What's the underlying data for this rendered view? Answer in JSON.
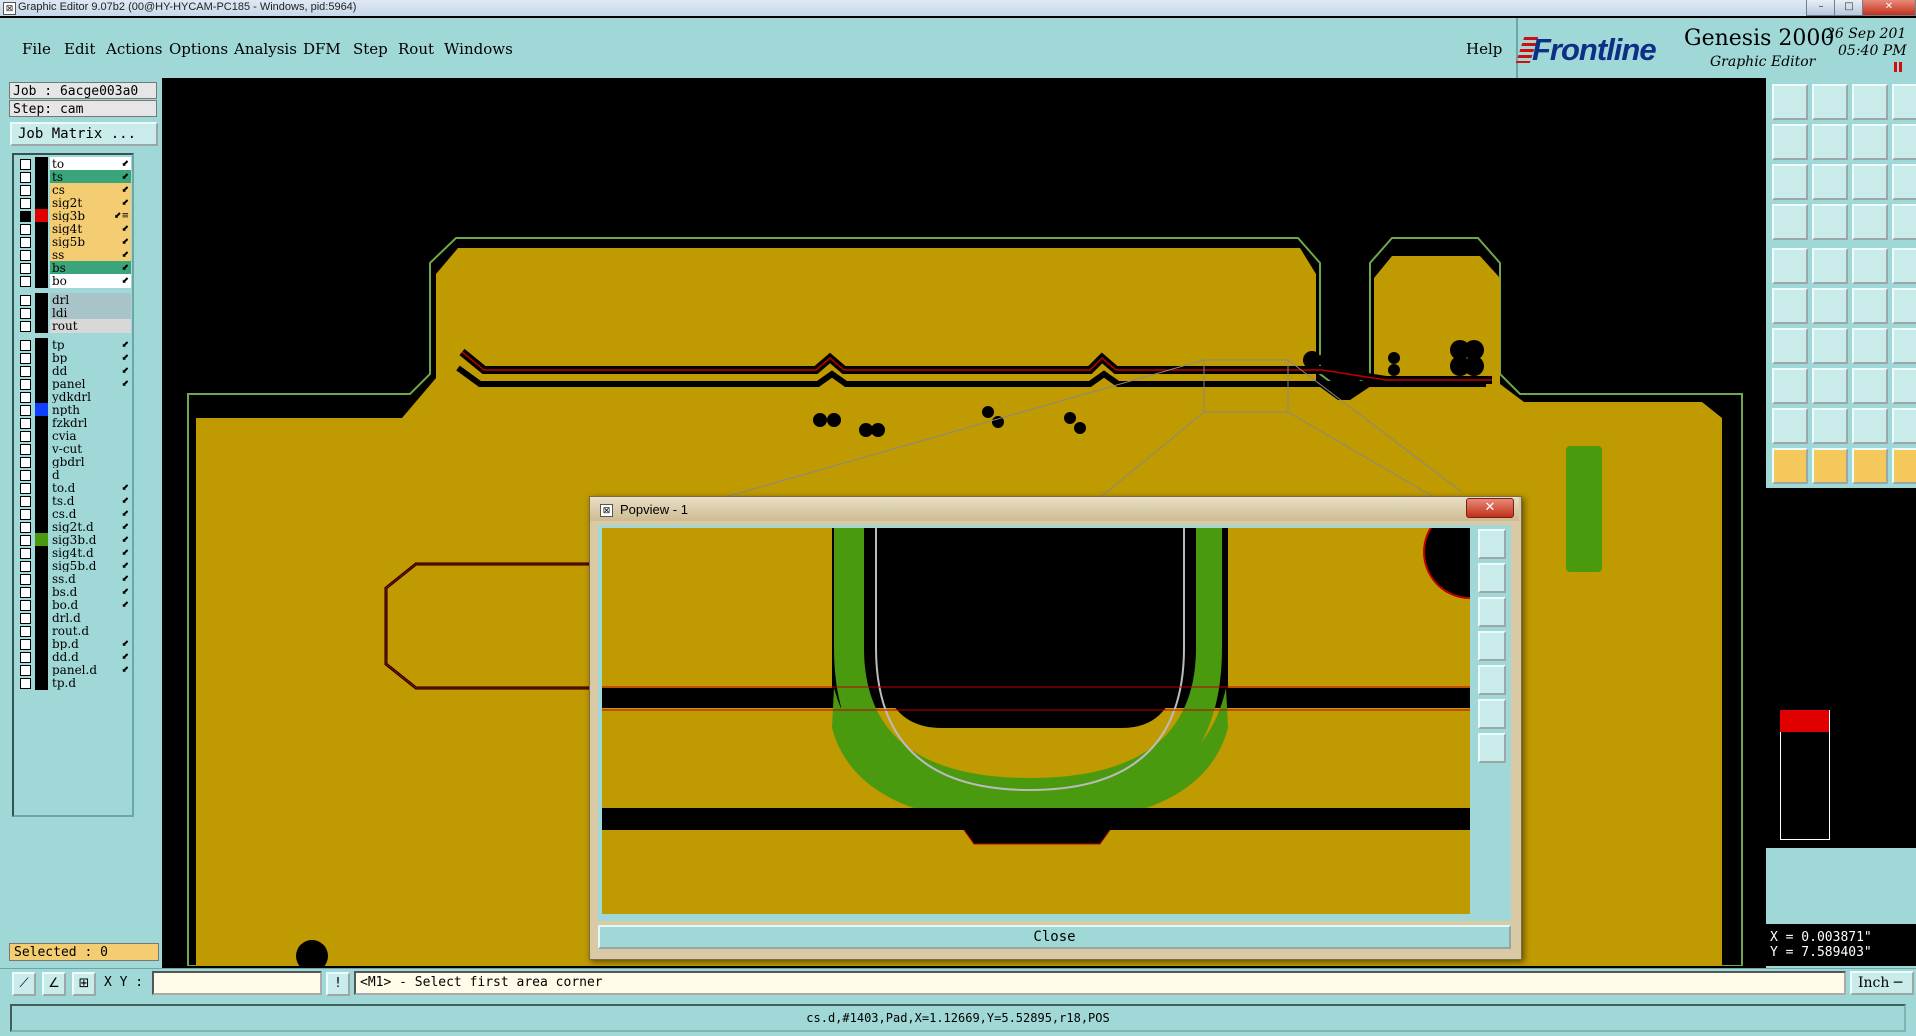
{
  "window": {
    "title": "Graphic Editor 9.07b2 (00@HY-HYCAM-PC185 - Windows, pid:5964)",
    "min": "–",
    "max": "□",
    "close": "✕"
  },
  "menu": [
    "File",
    "Edit",
    "Actions",
    "Options",
    "Analysis",
    "DFM",
    "Step",
    "Rout",
    "Windows"
  ],
  "help": "Help",
  "brand": {
    "logo": "Frontline",
    "product": "Genesis 2000",
    "sub": "Graphic Editor",
    "date": "26 Sep 201",
    "time": "05:40 PM"
  },
  "job": {
    "job": "Job : 6acge003a0",
    "step": "Step: cam",
    "matrix_button": "Job Matrix ..."
  },
  "layers": [
    {
      "name": "to",
      "color": "#ffffff",
      "arrow": "⬋"
    },
    {
      "name": "ts",
      "color": "#3aa57a",
      "arrow": "⬋"
    },
    {
      "name": "cs",
      "color": "#f4cd73",
      "arrow": "⬋"
    },
    {
      "name": "sig2t",
      "color": "#f4cd73",
      "arrow": "⬋"
    },
    {
      "name": "sig3b",
      "color": "#f4cd73",
      "arrow": "⬋≡",
      "selected": true
    },
    {
      "name": "sig4t",
      "color": "#f4cd73",
      "arrow": "⬋"
    },
    {
      "name": "sig5b",
      "color": "#f4cd73",
      "arrow": "⬋"
    },
    {
      "name": "ss",
      "color": "#f4cd73",
      "arrow": "⬋"
    },
    {
      "name": "bs",
      "color": "#3aa57a",
      "arrow": "⬋"
    },
    {
      "name": "bo",
      "color": "#ffffff",
      "arrow": "⬋"
    },
    {
      "name": "drl",
      "color": "#a8c4c8",
      "arrow": ""
    },
    {
      "name": "ldi",
      "color": "#a8c4c8",
      "arrow": ""
    },
    {
      "name": "rout",
      "color": "#d8d8d8",
      "arrow": ""
    },
    {
      "name": "tp",
      "color": "#9fd8d6",
      "arrow": "⬋"
    },
    {
      "name": "bp",
      "color": "#9fd8d6",
      "arrow": "⬋"
    },
    {
      "name": "dd",
      "color": "#9fd8d6",
      "arrow": "⬋"
    },
    {
      "name": "panel",
      "color": "#9fd8d6",
      "arrow": "⬋"
    },
    {
      "name": "ydkdrl",
      "color": "#9fd8d6",
      "arrow": ""
    },
    {
      "name": "npth",
      "color": "#9fd8d6",
      "arrow": "",
      "mark": "#1040ff"
    },
    {
      "name": "fzkdrl",
      "color": "#9fd8d6",
      "arrow": ""
    },
    {
      "name": "cvia",
      "color": "#9fd8d6",
      "arrow": ""
    },
    {
      "name": "v-cut",
      "color": "#9fd8d6",
      "arrow": ""
    },
    {
      "name": "gbdrl",
      "color": "#9fd8d6",
      "arrow": ""
    },
    {
      "name": "d",
      "color": "#9fd8d6",
      "arrow": ""
    },
    {
      "name": "to.d",
      "color": "#9fd8d6",
      "arrow": "⬋"
    },
    {
      "name": "ts.d",
      "color": "#9fd8d6",
      "arrow": "⬋"
    },
    {
      "name": "cs.d",
      "color": "#9fd8d6",
      "arrow": "⬋"
    },
    {
      "name": "sig2t.d",
      "color": "#9fd8d6",
      "arrow": "⬋"
    },
    {
      "name": "sig3b.d",
      "color": "#9fd8d6",
      "arrow": "⬋",
      "mark": "#4a9a10"
    },
    {
      "name": "sig4t.d",
      "color": "#9fd8d6",
      "arrow": "⬋"
    },
    {
      "name": "sig5b.d",
      "color": "#9fd8d6",
      "arrow": "⬋"
    },
    {
      "name": "ss.d",
      "color": "#9fd8d6",
      "arrow": "⬋"
    },
    {
      "name": "bs.d",
      "color": "#9fd8d6",
      "arrow": "⬋"
    },
    {
      "name": "bo.d",
      "color": "#9fd8d6",
      "arrow": "⬋"
    },
    {
      "name": "drl.d",
      "color": "#9fd8d6",
      "arrow": ""
    },
    {
      "name": "rout.d",
      "color": "#9fd8d6",
      "arrow": ""
    },
    {
      "name": "bp.d",
      "color": "#9fd8d6",
      "arrow": "⬋"
    },
    {
      "name": "dd.d",
      "color": "#9fd8d6",
      "arrow": "⬋"
    },
    {
      "name": "panel.d",
      "color": "#9fd8d6",
      "arrow": "⬋"
    },
    {
      "name": "tp.d",
      "color": "#9fd8d6",
      "arrow": ""
    }
  ],
  "selected": "Selected : 0",
  "popview": {
    "title": "Popview - 1",
    "close": "Close"
  },
  "coords": {
    "x": "X = 0.003871\"",
    "y": "Y = 7.589403\""
  },
  "cmd": {
    "xy_label": "X Y :",
    "xy_value": "",
    "prompt": "<M1> - Select first area corner",
    "units": "Inch ─"
  },
  "status": "cs.d,#1403,Pad,X=1.12669,Y=5.52895,r18,POS",
  "colors": {
    "copper": "#bf9a00",
    "mask": "#4a9a10",
    "outline": "#6fa84a",
    "trace_red": "#c00000",
    "panel": "#9fd8d6"
  }
}
